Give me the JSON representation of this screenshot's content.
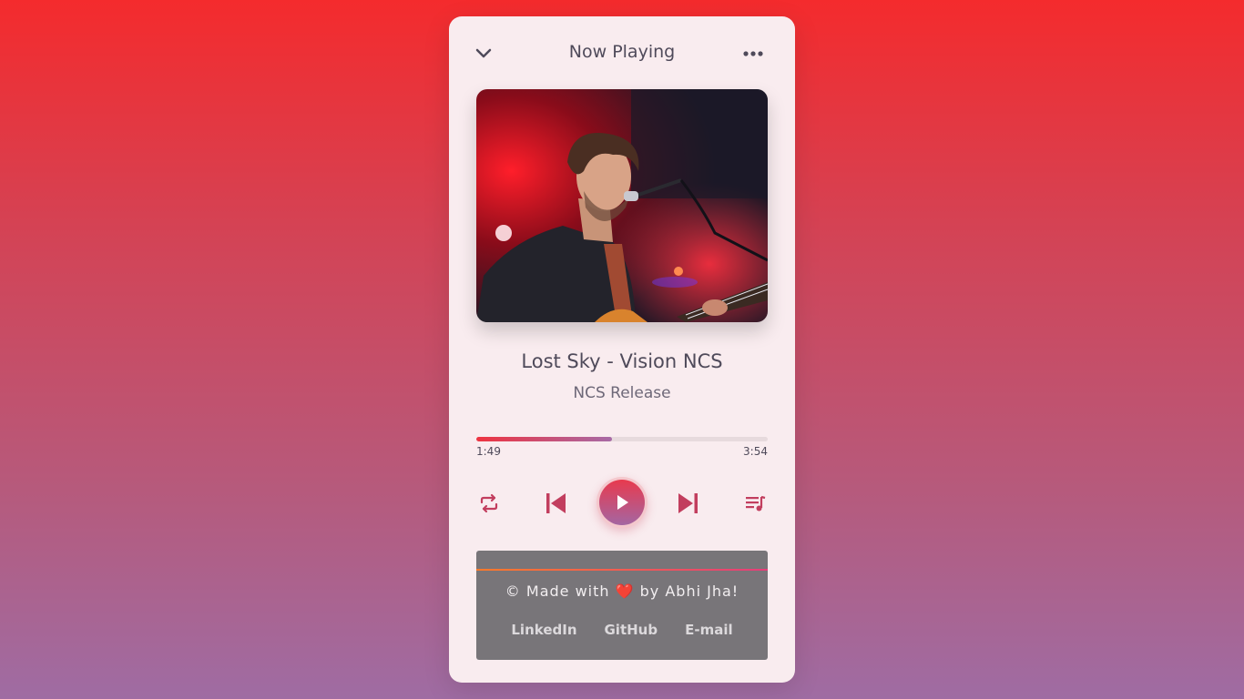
{
  "header": {
    "title": "Now Playing",
    "collapse_icon": "chevron-down-icon",
    "more_icon": "more-dots-icon"
  },
  "track": {
    "title": "Lost Sky - Vision NCS",
    "artist": "NCS Release"
  },
  "progress": {
    "current": "1:49",
    "total": "3:54",
    "fraction": 0.465
  },
  "controls": {
    "repeat_icon": "repeat-icon",
    "prev_icon": "skip-previous-icon",
    "play_icon": "play-icon",
    "next_icon": "skip-next-icon",
    "playlist_icon": "playlist-icon"
  },
  "footer": {
    "made_prefix": "© Made with",
    "heart": "❤️",
    "made_suffix": "by Abhi Jha!",
    "links": [
      "LinkedIn",
      "GitHub",
      "E-mail"
    ]
  },
  "colors": {
    "accent": "#d83a52",
    "icon": "#c23e5e",
    "text": "#4f4a5a"
  }
}
